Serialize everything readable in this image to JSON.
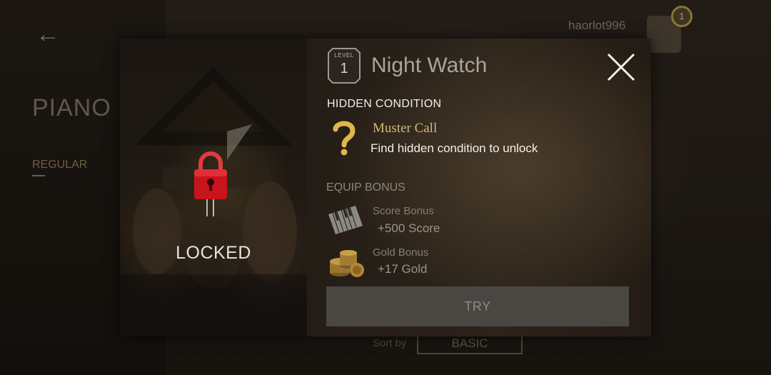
{
  "background": {
    "back_glyph": "←",
    "page_title": "PIANO",
    "tab_regular": "REGULAR",
    "username": "haorlot996",
    "notification_count": "1",
    "sort_label": "Sort by",
    "sort_value": "BASIC"
  },
  "card": {
    "status": "LOCKED",
    "level_word": "LEVEL",
    "level": "1",
    "title": "Night Watch"
  },
  "condition": {
    "heading": "HIDDEN CONDITION",
    "name": "Muster Call",
    "description": "Find hidden condition to unlock"
  },
  "equip": {
    "heading": "EQUIP BONUS",
    "score_label": "Score Bonus",
    "score_value": "+500 Score",
    "gold_label": "Gold Bonus",
    "gold_value": "+17 Gold"
  },
  "actions": {
    "try_label": "TRY"
  },
  "icons": {
    "close": "close-icon",
    "lock": "padlock-icon",
    "question": "question-mark-icon",
    "piano": "piano-keys-icon",
    "gold": "gold-coins-icon"
  },
  "colors": {
    "accent_gold": "#d3b77a",
    "lock_red": "#c8141c",
    "button_gray": "#4a4743"
  }
}
